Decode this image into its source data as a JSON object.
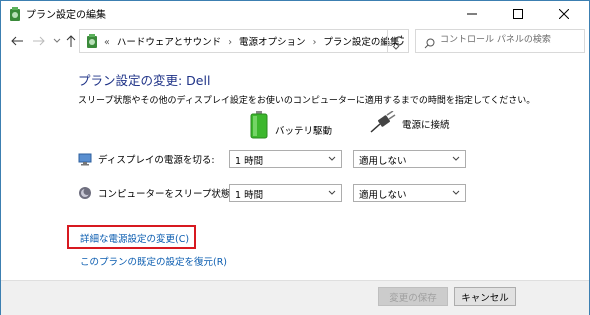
{
  "window": {
    "title": "プラン設定の編集",
    "controls": {
      "minimize": "minimize-icon",
      "maximize": "maximize-icon",
      "close": "close-icon"
    }
  },
  "nav": {
    "back": "back-arrow-icon",
    "forward": "forward-arrow-icon",
    "up": "up-arrow-icon",
    "breadcrumb_overflow": "«",
    "breadcrumbs": [
      "ハードウェアとサウンド",
      "電源オプション",
      "プラン設定の編集"
    ],
    "breadcrumb_sep": "›",
    "refresh": "refresh-icon",
    "search_placeholder": "コントロール パネルの検索"
  },
  "main": {
    "heading": "プラン設定の変更: Dell",
    "description": "スリープ状態やその他のディスプレイ設定をお使いのコンピューターに適用するまでの時間を指定してください。",
    "columns": {
      "battery": "バッテリ駆動",
      "plugged": "電源に接続"
    },
    "rows": [
      {
        "label": "ディスプレイの電源を切る:",
        "battery_value": "1 時間",
        "plugged_value": "適用しない"
      },
      {
        "label": "コンピューターをスリープ状態にする:",
        "battery_value": "1 時間",
        "plugged_value": "適用しない"
      }
    ],
    "links": {
      "advanced": "詳細な電源設定の変更(C)",
      "restore": "このプランの既定の設定を復元(R)"
    }
  },
  "footer": {
    "save": "変更の保存",
    "cancel": "キャンセル"
  },
  "colors": {
    "heading": "#1e3287",
    "link": "#0a5cb0",
    "highlight_border": "#d71920",
    "battery_green": "#3cb72d"
  }
}
